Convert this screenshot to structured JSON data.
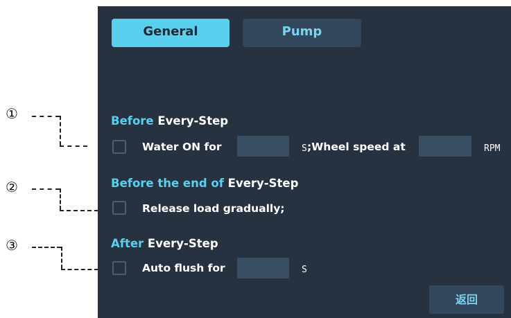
{
  "callouts": [
    "①",
    "②",
    "③"
  ],
  "tabs": {
    "general": "General",
    "pump": "Pump"
  },
  "sections": {
    "before": {
      "title_accent": "Before",
      "title_rest": " Every-Step",
      "water_label": "Water ON for",
      "water_value": "",
      "water_unit": "S",
      "wheel_label": ";Wheel speed at",
      "wheel_value": "",
      "wheel_unit": "RPM",
      "checked": false
    },
    "before_end": {
      "title_accent": "Before the end of",
      "title_rest": " Every-Step",
      "release_label": "Release load gradually;",
      "checked": false
    },
    "after": {
      "title_accent": "After",
      "title_rest": " Every-Step",
      "flush_label": "Auto flush for",
      "flush_value": "",
      "flush_unit": "S",
      "checked": false
    }
  },
  "back_button": "返回",
  "colors": {
    "panel": "#263240",
    "accent": "#5bcfee",
    "input": "#3a4e64",
    "button": "#33475c"
  }
}
